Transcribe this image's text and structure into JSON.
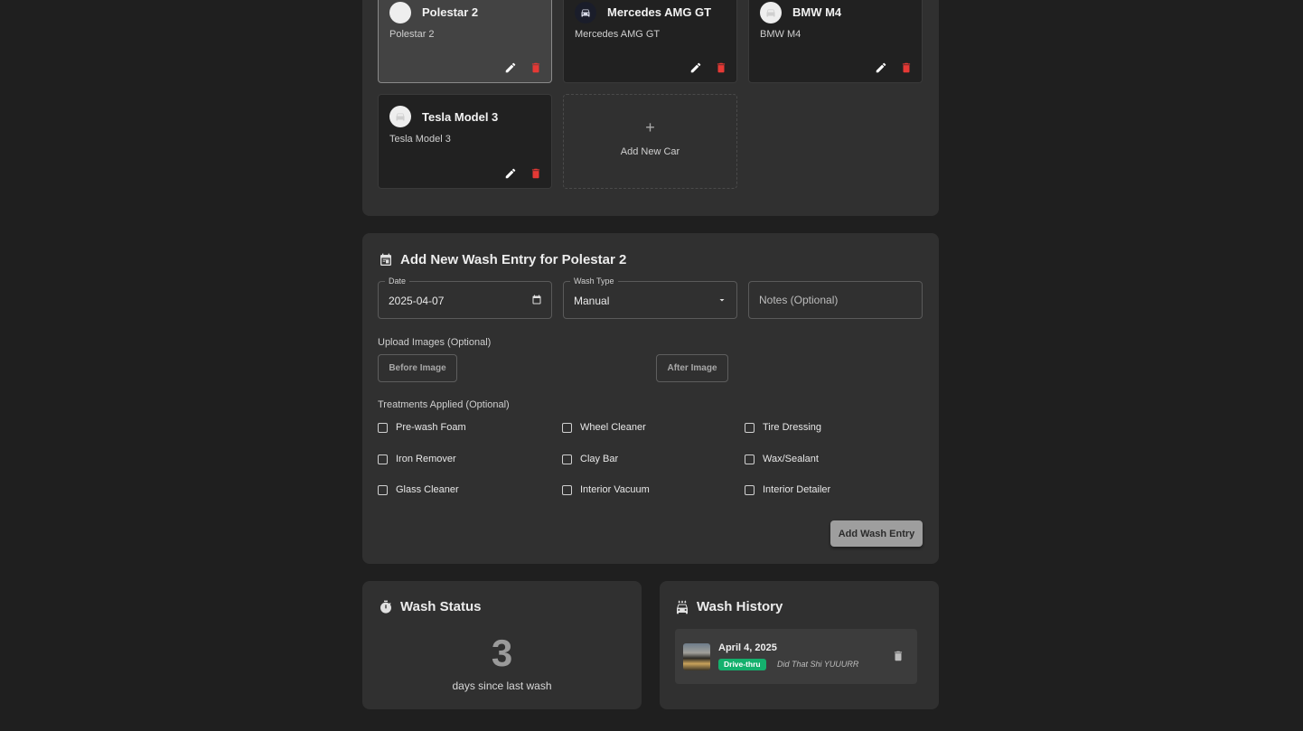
{
  "cars": [
    {
      "name": "Polestar 2",
      "subtitle": "Polestar 2",
      "avatar_icon": "blank-avatar",
      "selected": true
    },
    {
      "name": "Mercedes AMG GT",
      "subtitle": "Mercedes AMG GT",
      "avatar_icon": "car-icon",
      "selected": false
    },
    {
      "name": "BMW M4",
      "subtitle": "BMW M4",
      "avatar_icon": "car-icon",
      "selected": false
    },
    {
      "name": "Tesla Model 3",
      "subtitle": "Tesla Model 3",
      "avatar_icon": "car-icon",
      "selected": false
    }
  ],
  "add_car": {
    "plus": "+",
    "label": "Add New Car"
  },
  "wash_form": {
    "title": "Add New Wash Entry for Polestar 2",
    "date": {
      "legend": "Date",
      "value": "2025-04-07"
    },
    "wash_type": {
      "legend": "Wash Type",
      "value": "Manual"
    },
    "notes": {
      "placeholder": "Notes (Optional)"
    },
    "upload_label": "Upload Images (Optional)",
    "before_image": "Before Image",
    "after_image": "After Image",
    "treatments_label": "Treatments Applied (Optional)",
    "treatments": [
      {
        "label": "Pre-wash Foam",
        "checked": false
      },
      {
        "label": "Wheel Cleaner",
        "checked": false
      },
      {
        "label": "Tire Dressing",
        "checked": false
      },
      {
        "label": "Iron Remover",
        "checked": false
      },
      {
        "label": "Clay Bar",
        "checked": false
      },
      {
        "label": "Wax/Sealant",
        "checked": false
      },
      {
        "label": "Glass Cleaner",
        "checked": false
      },
      {
        "label": "Interior Vacuum",
        "checked": false
      },
      {
        "label": "Interior Detailer",
        "checked": false
      }
    ],
    "submit": "Add Wash Entry"
  },
  "wash_status": {
    "title": "Wash Status",
    "days": "3",
    "caption": "days since last wash"
  },
  "wash_history": {
    "title": "Wash History",
    "items": [
      {
        "date": "April 4, 2025",
        "type": "Drive-thru",
        "note": "Did That Shi YUUURR"
      }
    ]
  },
  "colors": {
    "background": "#1f1f1f",
    "panel": "#303030",
    "delete": "#e53935",
    "badge": "#14b06d"
  }
}
